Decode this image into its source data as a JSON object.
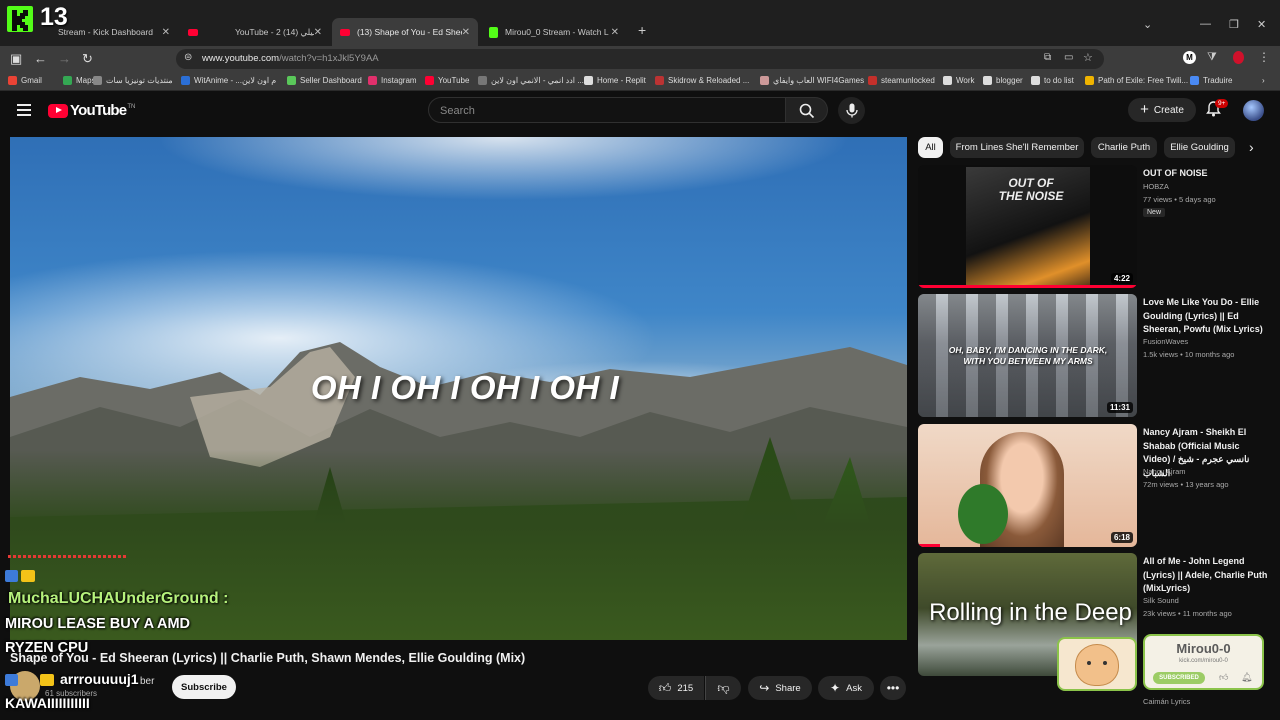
{
  "overlay": {
    "counter": "13"
  },
  "tabs": [
    {
      "title": "Stream - Kick Dashboard",
      "color": "#53fc18"
    },
    {
      "title": "",
      "color": "#ff0033"
    },
    {
      "title": "YouTube - 2 (14) ليلي",
      "color": "#ff0033"
    },
    {
      "title": "(13) Shape of You - Ed Sheeran",
      "color": "#ff0033"
    },
    {
      "title": "Mirou0_0 Stream - Watch L",
      "color": "#53fc18"
    }
  ],
  "address": {
    "host": "www.youtube.com",
    "path": "/watch?v=h1xJkl5Y9AA"
  },
  "bookmarks": [
    "Gmail",
    "Maps",
    "منتديات تونيزيا سات",
    "WitAnime - ...م اون لاين",
    "Seller Dashboard",
    "Instagram",
    "YouTube",
    "ادد انمي - الانمي اون لاين ...",
    "Home - Replit",
    "Skidrow & Reloaded ...",
    "العاب وايفاي WIFI4Games",
    "steamunlocked",
    "Work",
    "blogger",
    "to do list",
    "Path of Exile: Free Twili...",
    "Traduire"
  ],
  "youtube": {
    "logo": "YouTube",
    "logo_sup": "TN",
    "search_placeholder": "Search",
    "create_label": "Create",
    "notif_badge": "9+"
  },
  "video": {
    "lyrics": "OH I OH I OH I OH I",
    "title": "Shape of You - Ed Sheeran (Lyrics) || Charlie Puth, Shawn Mendes, Ellie Goulding (Mix)",
    "channel": "ber",
    "subscribers": "61 subscribers",
    "subscribe_label": "Subscribe",
    "likes": "215",
    "share_label": "Share",
    "ask_label": "Ask"
  },
  "chat": {
    "user1": "MuchaLUCHAUnderGround :",
    "msg1_line1": "MIROU LEASE BUY A AMD",
    "msg1_line2": "RYZEN CPU",
    "user2": "arrrouuuuj1",
    "msg2": "KAWAIIIIIIIIIII"
  },
  "chips": [
    "All",
    "From Lines She'll Remember",
    "Charlie Puth",
    "Ellie Goulding"
  ],
  "related": [
    {
      "title": "OUT OF NOISE",
      "channel": "HOBZA",
      "meta": "77 views • 5 days ago",
      "badge": "New",
      "duration": "4:22",
      "thumb_text": "OUT OF THE NOISE"
    },
    {
      "title": "Love Me Like You Do - Ellie Goulding (Lyrics) || Ed Sheeran, Powfu (Mix Lyrics)",
      "channel": "FusionWaves",
      "meta": "1.5k views • 10 months ago",
      "duration": "11:31",
      "thumb_text": "OH, BABY, I'M DANCING IN THE DARK, WITH YOU BETWEEN MY ARMS"
    },
    {
      "title": "Nancy Ajram - Sheikh El Shabab (Official Music Video) / نانسي عجرم - شيخ الشباب",
      "channel": "Nancy Ajram",
      "meta": "72m views • 13 years ago",
      "duration": "6:18"
    },
    {
      "title": "All of Me - John Legend (Lyrics) || Adele, Charlie Puth (MixLyrics)",
      "channel": "Silk Sound",
      "meta": "23k views • 11 months ago",
      "thumb_text": "Rolling in the Deep"
    }
  ],
  "last_channel": "Caimán Lyrics",
  "stream_card": {
    "name": "Mirou0-0",
    "url": "kick.com/mirou0-0",
    "button": "SUBSCRIBED"
  }
}
